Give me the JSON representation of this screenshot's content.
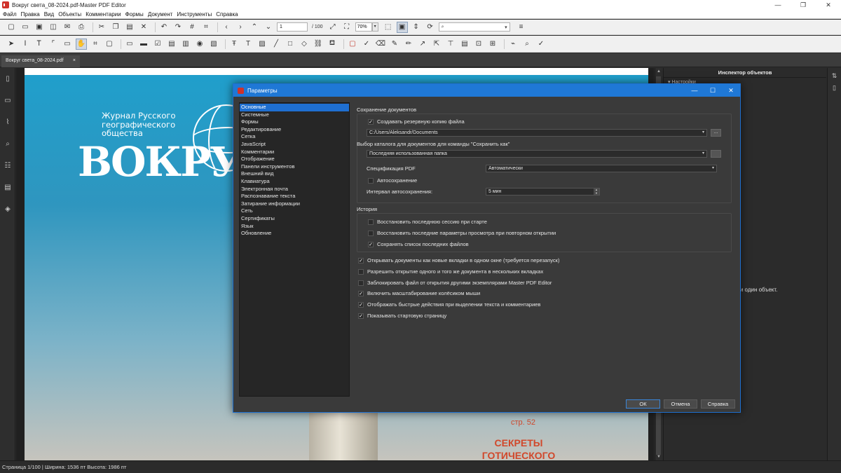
{
  "window": {
    "title": "Вокруг света_08-2024.pdf-Master PDF Editor",
    "minimize": "—",
    "maximize": "❐",
    "close": "✕"
  },
  "menu": [
    "Файл",
    "Правка",
    "Вид",
    "Объекты",
    "Комментарии",
    "Формы",
    "Документ",
    "Инструменты",
    "Справка"
  ],
  "toolbar": {
    "page_current": "1",
    "page_total": "/ 100",
    "zoom": "70%",
    "search_placeholder": ""
  },
  "tab": {
    "label": "Вокруг света_08-2024.pdf",
    "close": "×"
  },
  "document": {
    "subtitle_lines": [
      "Журнал Русского",
      "географического",
      "общества"
    ],
    "magazine_title": "ВОКРУГ",
    "page_ref": "стр. 52",
    "headline_lines": [
      "СЕКРЕТЫ",
      "ГОТИЧЕСКОГО"
    ]
  },
  "inspector": {
    "title": "Инспектор объектов",
    "settings": "▾ Настройки",
    "note": "ели один объект."
  },
  "statusbar": {
    "text": "Страница 1/100 | Ширина: 1536 пт Высота: 1986 пт"
  },
  "dialog": {
    "title": "Параметры",
    "nav": [
      "Основные",
      "Системные",
      "Формы",
      "Редактирование",
      "Сетка",
      "JavaScript",
      "Комментарии",
      "Отображение",
      "Панели инструментов",
      "Внешний вид",
      "Клавиатура",
      "Электронная почта",
      "Распознавание текста",
      "Затирание информации",
      "Сеть",
      "Сертификаты",
      "Язык",
      "Обновление"
    ],
    "selected_nav": "Основные",
    "save_group": {
      "label": "Сохранение документов",
      "backup": {
        "label": "Создавать резервную копию файла",
        "checked": true
      },
      "backup_path": "C:/Users/Aleksandr/Documents",
      "browse_label": "...",
      "dir_label": "Выбор каталога для документов для команды \"Сохранить как\"",
      "dir_value": "Последняя использованная папка",
      "spec_label": "Спецификация PDF",
      "spec_value": "Автоматически",
      "autosave": {
        "label": "Автосохранение",
        "checked": false
      },
      "interval_label": "Интервал автосохранения:",
      "interval_value": "5 мин"
    },
    "history_group": {
      "label": "История",
      "items": [
        {
          "label": "Восстановить последнюю сессию при старте",
          "checked": false
        },
        {
          "label": "Восстановить последние параметры просмотра при повторном открытии",
          "checked": false
        },
        {
          "label": "Сохранять список последних файлов",
          "checked": true
        }
      ]
    },
    "options": [
      {
        "label": "Открывать документы как новые вкладки в одном окне (требуется перезапуск)",
        "checked": true
      },
      {
        "label": "Разрешить открытие одного и того же документа в нескольких вкладках",
        "checked": false
      },
      {
        "label": "Заблокировать файл от открытия другими экземплярами Master PDF Editor",
        "checked": false
      },
      {
        "label": "Включить масштабирование колёсиком мыши",
        "checked": true
      },
      {
        "label": "Отображать быстрые действия при выделении текста и комментариев",
        "checked": true
      },
      {
        "label": "Показывать стартовую страницу",
        "checked": true
      }
    ],
    "buttons": {
      "ok": "ОК",
      "cancel": "Отмена",
      "help": "Справка"
    },
    "check_mark": "✓"
  }
}
